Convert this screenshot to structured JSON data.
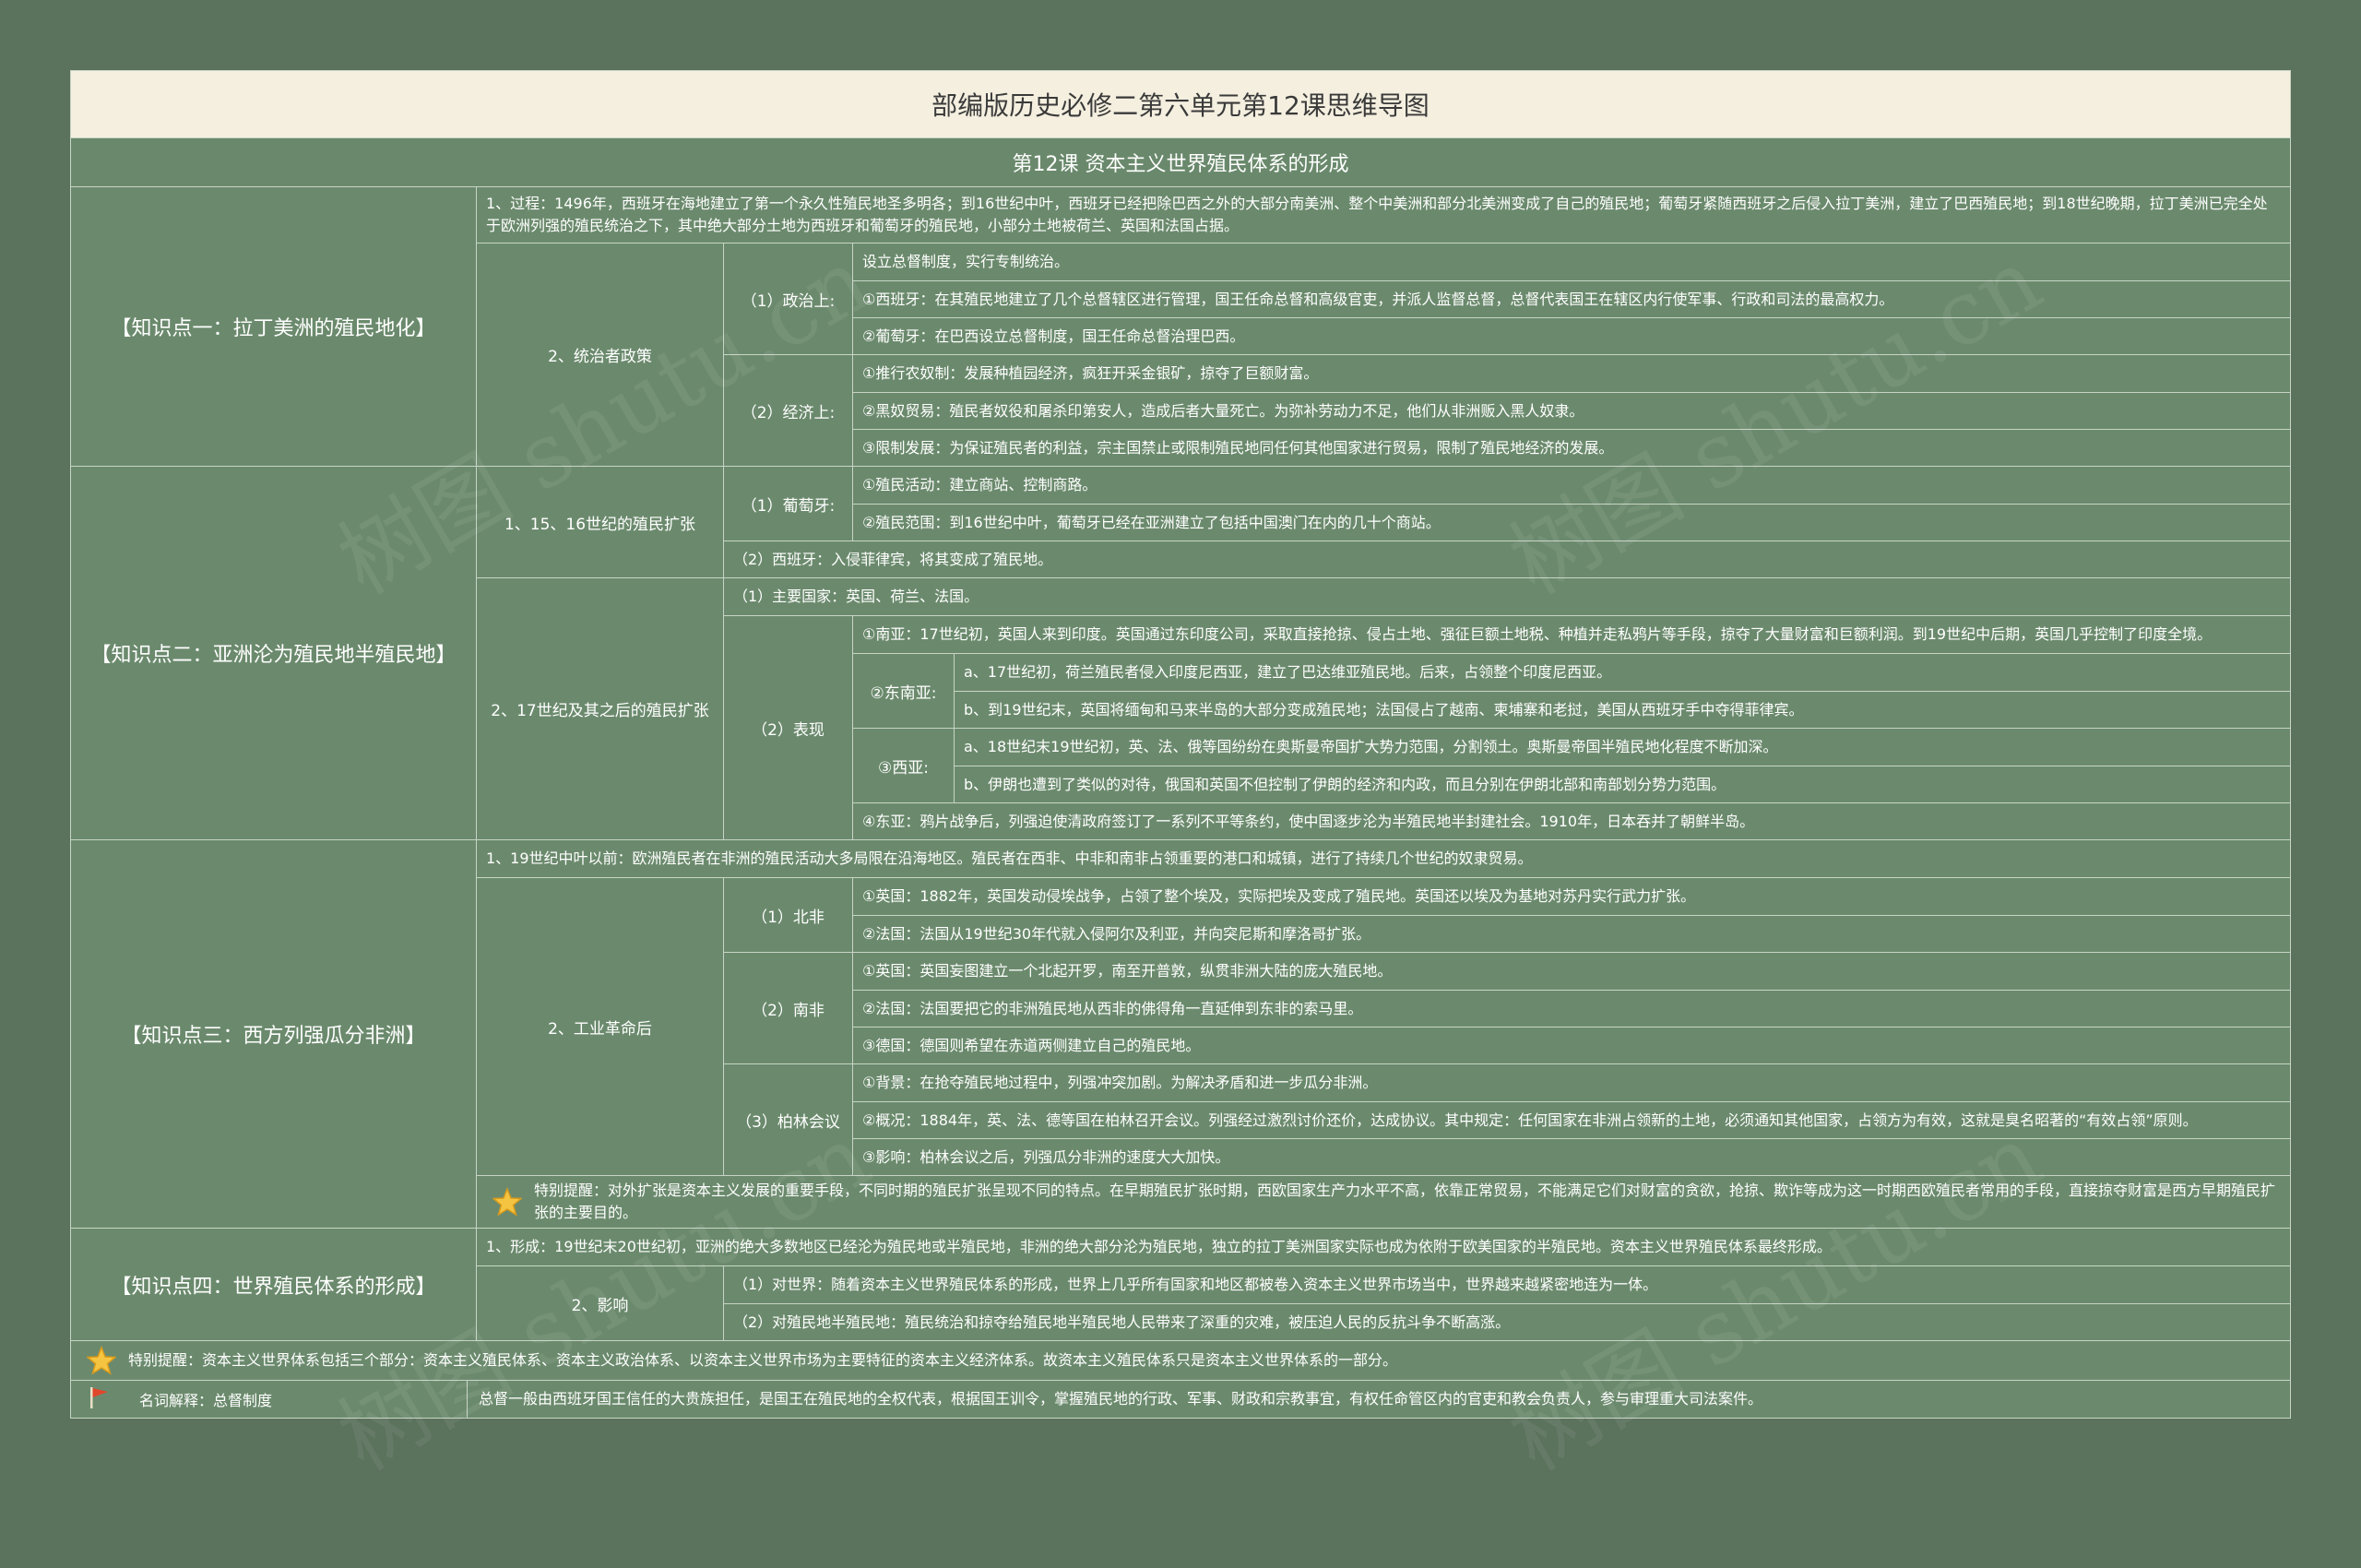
{
  "title": "部编版历史必修二第六单元第12课思维导图",
  "subtitle": "第12课 资本主义世界殖民体系的形成",
  "watermark": "树图 shutu.cn",
  "colors": {
    "background": "#5b725c",
    "panel": "#6b8a6d",
    "title_bg": "#f4efdf",
    "border": "#c8d4c6"
  },
  "s1": {
    "label": "【知识点一：拉丁美洲的殖民地化】",
    "p1": "1、过程：1496年，西班牙在海地建立了第一个永久性殖民地圣多明各；到16世纪中叶，西班牙已经把除巴西之外的大部分南美洲、整个中美洲和部分北美洲变成了自己的殖民地；葡萄牙紧随西班牙之后侵入拉丁美洲，建立了巴西殖民地；到18世纪晚期，拉丁美洲已完全处于欧洲列强的殖民统治之下，其中绝大部分土地为西班牙和葡萄牙的殖民地，小部分土地被荷兰、英国和法国占据。",
    "p2": "2、统治者政策",
    "pol_label": "（1）政治上:",
    "pol": [
      "设立总督制度，实行专制统治。",
      "①西班牙：在其殖民地建立了几个总督辖区进行管理，国王任命总督和高级官吏，并派人监督总督，总督代表国王在辖区内行使军事、行政和司法的最高权力。",
      "②葡萄牙：在巴西设立总督制度，国王任命总督治理巴西。"
    ],
    "eco_label": "（2）经济上:",
    "eco": [
      "①推行农奴制：发展种植园经济，疯狂开采金银矿，掠夺了巨额财富。",
      "②黑奴贸易：殖民者奴役和屠杀印第安人，造成后者大量死亡。为弥补劳动力不足，他们从非洲贩入黑人奴隶。",
      "③限制发展：为保证殖民者的利益，宗主国禁止或限制殖民地同任何其他国家进行贸易，限制了殖民地经济的发展。"
    ]
  },
  "s2": {
    "label": "【知识点二：亚洲沦为殖民地半殖民地】",
    "p1": "1、15、16世纪的殖民扩张",
    "pt_label": "（1）葡萄牙:",
    "pt": [
      "①殖民活动：建立商站、控制商路。",
      "②殖民范围：到16世纪中叶，葡萄牙已经在亚洲建立了包括中国澳门在内的几十个商站。"
    ],
    "es": "（2）西班牙：入侵菲律宾，将其变成了殖民地。",
    "p2": "2、17世纪及其之后的殖民扩张",
    "main": "（1）主要国家：英国、荷兰、法国。",
    "show_label": "（2）表现",
    "south": "①南亚：17世纪初，英国人来到印度。英国通过东印度公司，采取直接抢掠、侵占土地、强征巨额土地税、种植并走私鸦片等手段，掠夺了大量财富和巨额利润。到19世纪中后期，英国几乎控制了印度全境。",
    "se_label": "②东南亚:",
    "se": [
      "a、17世纪初，荷兰殖民者侵入印度尼西亚，建立了巴达维亚殖民地。后来，占领整个印度尼西亚。",
      "b、到19世纪末，英国将缅甸和马来半岛的大部分变成殖民地；法国侵占了越南、柬埔寨和老挝，美国从西班牙手中夺得菲律宾。"
    ],
    "w_label": "③西亚:",
    "w": [
      "a、18世纪末19世纪初，英、法、俄等国纷纷在奥斯曼帝国扩大势力范围，分割领土。奥斯曼帝国半殖民地化程度不断加深。",
      "b、伊朗也遭到了类似的对待，俄国和英国不但控制了伊朗的经济和内政，而且分别在伊朗北部和南部划分势力范围。"
    ],
    "east": "④东亚：鸦片战争后，列强迫使清政府签订了一系列不平等条约，使中国逐步沦为半殖民地半封建社会。1910年，日本吞并了朝鲜半岛。"
  },
  "s3": {
    "label": "【知识点三：西方列强瓜分非洲】",
    "p1": "1、19世纪中叶以前：欧洲殖民者在非洲的殖民活动大多局限在沿海地区。殖民者在西非、中非和南非占领重要的港口和城镇，进行了持续几个世纪的奴隶贸易。",
    "p2": "2、工业革命后",
    "n_label": "（1）北非",
    "n": [
      "①英国：1882年，英国发动侵埃战争，占领了整个埃及，实际把埃及变成了殖民地。英国还以埃及为基地对苏丹实行武力扩张。",
      "②法国：法国从19世纪30年代就入侵阿尔及利亚，并向突尼斯和摩洛哥扩张。"
    ],
    "s_label": "（2）南非",
    "s": [
      "①英国：英国妄图建立一个北起开罗，南至开普敦，纵贯非洲大陆的庞大殖民地。",
      "②法国：法国要把它的非洲殖民地从西非的佛得角一直延伸到东非的索马里。",
      "③德国：德国则希望在赤道两侧建立自己的殖民地。"
    ],
    "b_label": "（3）柏林会议",
    "b": [
      "①背景：在抢夺殖民地过程中，列强冲突加剧。为解决矛盾和进一步瓜分非洲。",
      "②概况：1884年，英、法、德等国在柏林召开会议。列强经过激烈讨价还价，达成协议。其中规定：任何国家在非洲占领新的土地，必须通知其他国家，占领方为有效，这就是臭名昭著的“有效占领”原则。",
      "③影响：柏林会议之后，列强瓜分非洲的速度大大加快。"
    ],
    "tip": "特别提醒：对外扩张是资本主义发展的重要手段，不同时期的殖民扩张呈现不同的特点。在早期殖民扩张时期，西欧国家生产力水平不高，依靠正常贸易，不能满足它们对财富的贪欲，抢掠、欺诈等成为这一时期西欧殖民者常用的手段，直接掠夺财富是西方早期殖民扩张的主要目的。"
  },
  "s4": {
    "label": "【知识点四：世界殖民体系的形成】",
    "p1": "1、形成：19世纪末20世纪初，亚洲的绝大多数地区已经沦为殖民地或半殖民地，非洲的绝大部分沦为殖民地，独立的拉丁美洲国家实际也成为依附于欧美国家的半殖民地。资本主义世界殖民体系最终形成。",
    "p2": "2、影响",
    "inf": [
      "（1）对世界：随着资本主义世界殖民体系的形成，世界上几乎所有国家和地区都被卷入资本主义世界市场当中，世界越来越紧密地连为一体。",
      "（2）对殖民地半殖民地：殖民统治和掠夺给殖民地半殖民地人民带来了深重的灾难，被压迫人民的反抗斗争不断高涨。"
    ]
  },
  "tip2": "特别提醒：资本主义世界体系包括三个部分：资本主义殖民体系、资本主义政治体系、以资本主义世界市场为主要特征的资本主义经济体系。故资本主义殖民体系只是资本主义世界体系的一部分。",
  "term": {
    "label": "名词解释：总督制度",
    "text": "总督一般由西班牙国王信任的大贵族担任，是国王在殖民地的全权代表，根据国王训令，掌握殖民地的行政、军事、财政和宗教事宜，有权任命管区内的官吏和教会负责人，参与审理重大司法案件。"
  },
  "icons": {
    "tip": "star-icon",
    "term": "flag-icon"
  }
}
